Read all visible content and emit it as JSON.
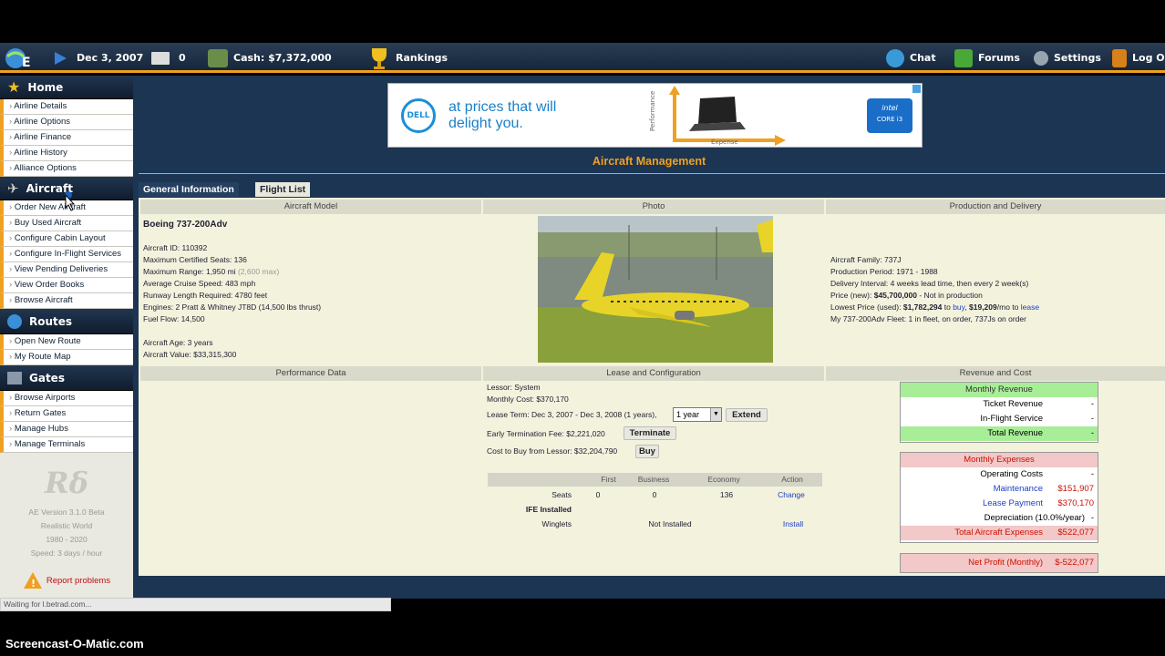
{
  "topbar": {
    "date": "Dec 3, 2007",
    "messages": "0",
    "cash": "Cash: $7,372,000",
    "rankings": "Rankings",
    "chat": "Chat",
    "forums": "Forums",
    "settings": "Settings",
    "logout": "Log Out"
  },
  "sidebar": {
    "home": "Home",
    "home_items": [
      "Airline Details",
      "Airline Options",
      "Airline Finance",
      "Airline History",
      "Alliance Options"
    ],
    "aircraft": "Aircraft",
    "aircraft_items": [
      "Order New Aircraft",
      "Buy Used Aircraft",
      "Configure Cabin Layout",
      "Configure In-Flight Services",
      "View Pending Deliveries",
      "View Order Books",
      "Browse Aircraft"
    ],
    "routes": "Routes",
    "routes_items": [
      "Open New Route",
      "My Route Map"
    ],
    "gates": "Gates",
    "gates_items": [
      "Browse Airports",
      "Return Gates",
      "Manage Hubs",
      "Manage Terminals"
    ],
    "version": "AE Version 3.1.0 Beta",
    "world": "Realistic World",
    "years": "1980 - 2020",
    "speed": "Speed: 3 days / hour",
    "report": "Report problems"
  },
  "ad": {
    "brand": "DELL",
    "line1": "at prices that will",
    "line2": "delight you.",
    "yaxis": "Performance",
    "xaxis": "Expense",
    "chip1": "intel",
    "chip2": "CORE i3"
  },
  "page_title": "Aircraft Management",
  "tabs": [
    "General Information",
    "Flight List"
  ],
  "headers": {
    "model": "Aircraft Model",
    "photo": "Photo",
    "production": "Production and Delivery",
    "performance": "Performance Data",
    "lease": "Lease and Configuration",
    "revenue": "Revenue and Cost"
  },
  "model": {
    "name": "Boeing 737-200Adv",
    "id": "Aircraft ID: 110392",
    "seats": "Maximum Certified Seats: 136",
    "range": "Maximum Range: 1,950 mi",
    "range_extra": "(2,600 max)",
    "speed": "Average Cruise Speed: 483 mph",
    "runway": "Runway Length Required: 4780 feet",
    "engines": "Engines: 2 Pratt & Whitney JT8D (14,500 lbs thrust)",
    "fuel": "Fuel Flow: 14,500",
    "age": "Aircraft Age: 3 years",
    "value": "Aircraft Value: $33,315,300"
  },
  "production": {
    "family": "Aircraft Family: 737J",
    "period": "Production Period: 1971 - 1988",
    "interval": "Delivery Interval: 4 weeks lead time, then every 2 week(s)",
    "price_pre": "Price (new): ",
    "price": "$45,700,000",
    "price_post": " - Not in production",
    "lowest_pre": "Lowest Price (used): ",
    "lowest": "$1,782,294",
    "to": " to ",
    "buy": "buy",
    "comma": ", ",
    "lease_price": "$19,209",
    "per": "/mo to ",
    "lease": "lease",
    "fleet": "My 737-200Adv Fleet: 1 in fleet, on order, 737Js on order"
  },
  "lease": {
    "lessor": "Lessor: System",
    "monthly": "Monthly Cost: $370,170",
    "term": "Lease Term: Dec 3, 2007 - Dec 3, 2008 (1 years),",
    "term_select": "1 year",
    "extend": "Extend",
    "early": "Early Termination Fee: $2,221,020",
    "terminate": "Terminate",
    "cost_buy": "Cost to Buy from Lessor: $32,204,790",
    "buy": "Buy"
  },
  "config": {
    "headers": [
      "First",
      "Business",
      "Economy",
      "Action"
    ],
    "seats_label": "Seats",
    "seats": [
      "0",
      "0",
      "136"
    ],
    "seats_action": "Change",
    "ife_label": "IFE Installed",
    "winglets_label": "Winglets",
    "winglets_value": "Not Installed",
    "winglets_action": "Install"
  },
  "revenue": {
    "title": "Monthly Revenue",
    "rows": [
      {
        "label": "Ticket Revenue",
        "value": "-"
      },
      {
        "label": "In-Flight Service",
        "value": "-"
      }
    ],
    "total_label": "Total Revenue",
    "total_value": "-"
  },
  "expenses": {
    "title": "Monthly Expenses",
    "op_label": "Operating Costs",
    "op_value": "-",
    "maint_label": "Maintenance",
    "maint_value": "$151,907",
    "lease_label": "Lease Payment",
    "lease_value": "$370,170",
    "dep_label": "Depreciation (10.0%/year)",
    "dep_value": "-",
    "total_label": "Total Aircraft Expenses",
    "total_value": "$522,077"
  },
  "net": {
    "label": "Net Profit (Monthly)",
    "value": "$-522,077"
  },
  "status": "Waiting for l.betrad.com...",
  "watermark": "Screencast-O-Matic.com",
  "colors": {
    "accent": "#f0a020",
    "nav": "#1c3552",
    "panel": "#f3f2dd",
    "green": "#a8ee98",
    "pink": "#f2c8c8"
  }
}
